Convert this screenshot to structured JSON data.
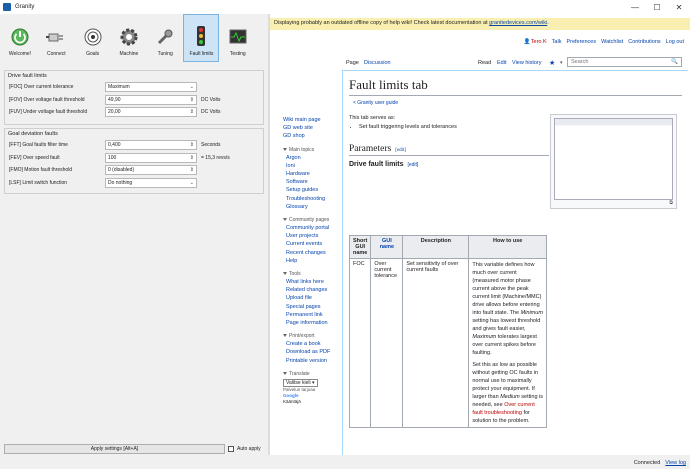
{
  "window": {
    "title": "Granity"
  },
  "toolbar": {
    "buttons": [
      {
        "label": "Welcome!"
      },
      {
        "label": "Connect"
      },
      {
        "label": "Goals"
      },
      {
        "label": "Machine"
      },
      {
        "label": "Tuning"
      },
      {
        "label": "Fault limits"
      },
      {
        "label": "Testing"
      }
    ]
  },
  "drive_fault_limits": {
    "title": "Drive fault limits",
    "foc": {
      "label": "[FOC] Over current tolerance",
      "value": "Maximum"
    },
    "fov": {
      "label": "[FOV] Over voltage fault threshold",
      "value": "49,90",
      "unit": "DC Volts"
    },
    "fuv": {
      "label": "[FUV] Under voltage fault threshold",
      "value": "20,00",
      "unit": "DC Volts"
    }
  },
  "goal_deviation_faults": {
    "title": "Goal deviation faults",
    "fft": {
      "label": "[FFT] Goal faults filter time",
      "value": "0,400",
      "unit": "Seconds"
    },
    "fev": {
      "label": "[FEV] Over speed fault",
      "value": "100",
      "unit": "= 15,3 revs/s"
    },
    "fmo": {
      "label": "[FMO] Motion fault threshold",
      "value": "0 (disabled)"
    },
    "lsf": {
      "label": "[LSF] Limit switch function",
      "value": "Do nothing"
    }
  },
  "bottom": {
    "apply_label": "Apply settings [Alt+A]",
    "auto_apply_label": "Auto apply"
  },
  "browser": {
    "banner_text": "Displaying probably an outdated offline copy of help wiki! Check latest documentation at ",
    "banner_link": "granitedevices.com/wiki",
    "banner_end": ".",
    "personal": {
      "user": "Tero K",
      "talk": "Talk",
      "prefs": "Preferences",
      "watchlist": "Watchlist",
      "contribs": "Contributions",
      "logout": "Log out"
    },
    "tabs": {
      "page": "Page",
      "discussion": "Discussion",
      "read": "Read",
      "edit": "Edit",
      "history": "View history",
      "star": "★"
    },
    "search_placeholder": "Search",
    "sidebar": {
      "top": [
        "Wiki main page",
        "GD web site",
        "GD shop"
      ],
      "main_topics_h": "Main topics",
      "main_topics": [
        "Argon",
        "Ioni",
        "Hardware",
        "Software",
        "Setup guides",
        "Troubleshooting",
        "Glossary"
      ],
      "community_h": "Community pages",
      "community": [
        "Community portal",
        "User projects",
        "Current events",
        "Recent changes",
        "Help"
      ],
      "tools_h": "Tools",
      "tools": [
        "What links here",
        "Related changes",
        "Upload file",
        "Special pages",
        "Permanent link",
        "Page information"
      ],
      "print_h": "Print/export",
      "print": [
        "Create a book",
        "Download as PDF",
        "Printable version"
      ],
      "translate_h": "Translate",
      "translate_select": "Valitse kieli",
      "powered": "Palvelun tarjoaa",
      "google": "Google",
      "kaantaja": "Kääntäjä"
    },
    "article": {
      "title": "Fault limits tab",
      "back": "< Granity user guide",
      "intro": "This tab serves as:",
      "bullet": "Set fault triggering levels and tolerances",
      "h2": "Parameters",
      "h2_edit": "[edit]",
      "h3": "Drive fault limits",
      "h3_edit": "[edit]",
      "table_headers": [
        "Short GUI name",
        "GUI name",
        "Description",
        "How to use"
      ],
      "row": {
        "short": "FOC",
        "name": "Over current tolerance",
        "desc": "Set sensitivity of over current faults",
        "use1": "This variable defines how much over current (measured motor phase current above the peak current limit (Machine/MMC) drive allows before entering into fault state. The ",
        "minimum": "Minimum",
        "use2": " setting has lowest threshold and gives fault easier, ",
        "maximum": "Maximum",
        "use3": " tolerates largest over current spikes before faulting.",
        "use4": "Set this as low as possible without getting OC faults in normal use to maximally protect your equipment. If larger than ",
        "medium": "Medium",
        "use5": " setting is needed, see ",
        "link": "Over current fault troubleshooting",
        "use6": " for solution to the problem."
      }
    }
  },
  "statusbar": {
    "connected": "Connected",
    "view_log": "View log"
  },
  "colors": {
    "accent": "#0645ad",
    "banner": "#f9efb0",
    "active_tab": "#cde4f7"
  }
}
